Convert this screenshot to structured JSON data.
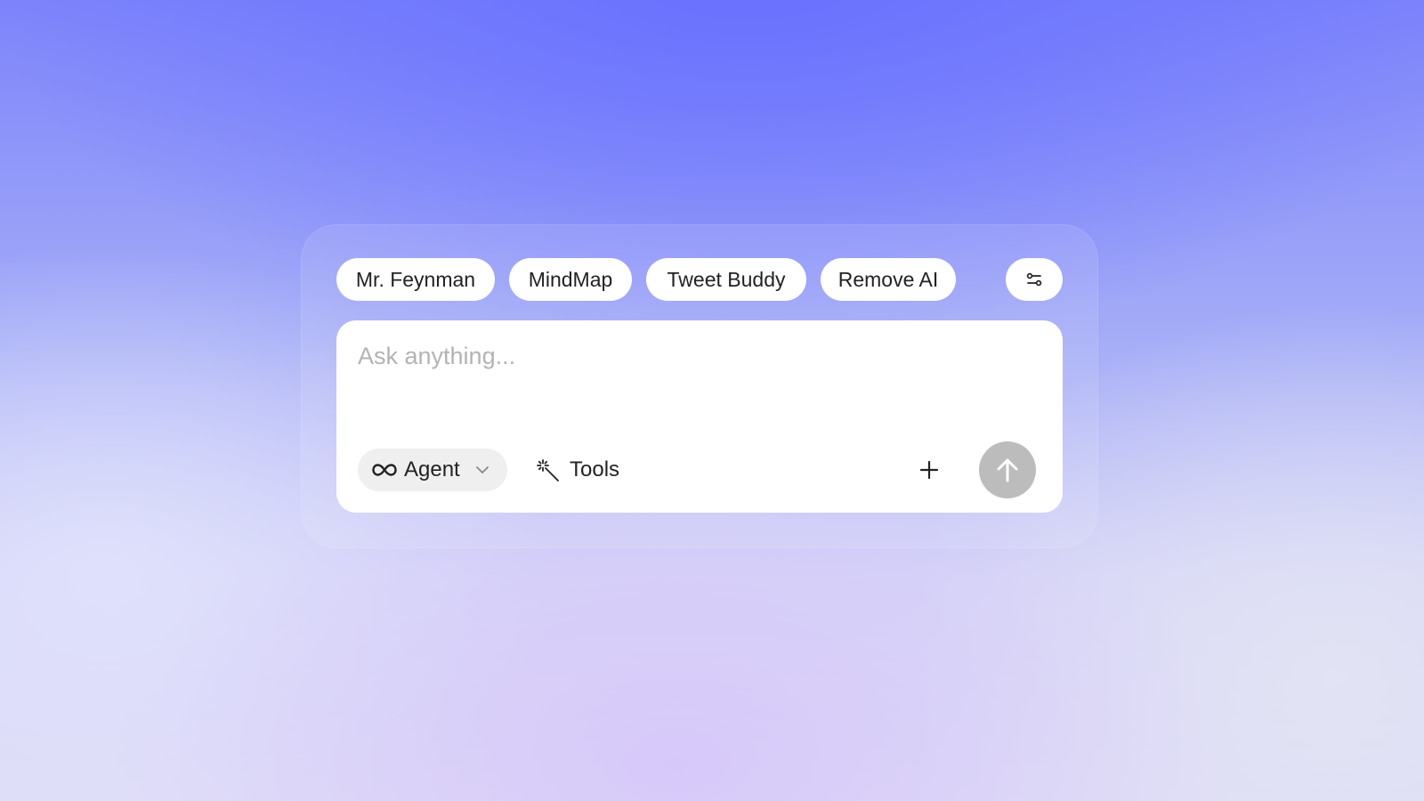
{
  "quick_prompts": [
    {
      "label": "Mr. Feynman"
    },
    {
      "label": "MindMap"
    },
    {
      "label": "Tweet Buddy"
    },
    {
      "label": "Remove AI"
    }
  ],
  "settings": {
    "icon": "sliders-icon"
  },
  "composer": {
    "placeholder": "Ask anything...",
    "value": "",
    "mode": {
      "label": "Agent",
      "icon": "infinity-icon",
      "expand_icon": "chevron-down-icon"
    },
    "tools": {
      "label": "Tools",
      "icon": "magic-wand-icon"
    },
    "attach": {
      "icon": "plus-icon"
    },
    "send": {
      "icon": "arrow-up-icon",
      "color": "#bcbcbc"
    }
  }
}
